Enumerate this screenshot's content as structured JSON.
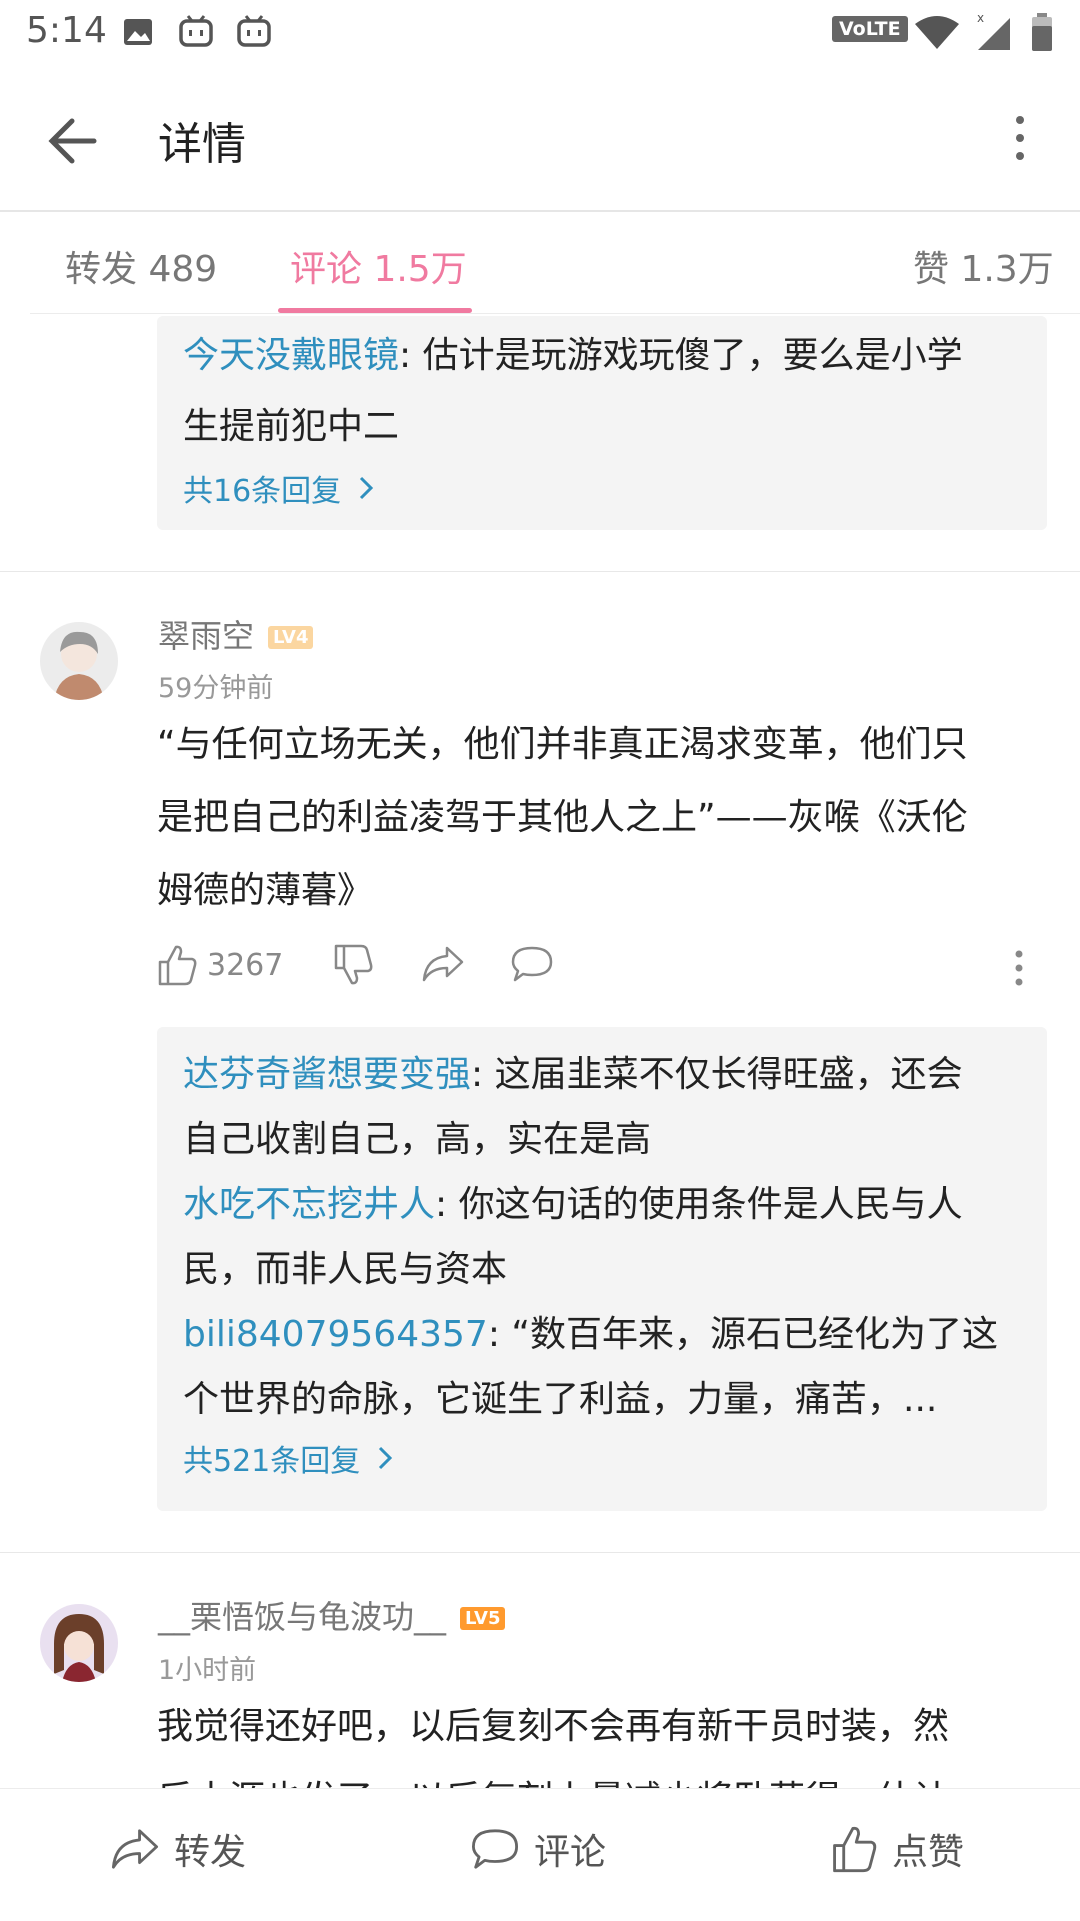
{
  "status_bar": {
    "time": "5:14",
    "volte": "VoLTE"
  },
  "app_bar": {
    "title": "详情"
  },
  "tabs": [
    {
      "label": "转发 489"
    },
    {
      "label": "评论 1.5万"
    },
    {
      "label": "赞 1.3万"
    }
  ],
  "prev_replies": {
    "items": [
      {
        "user": "今天没戴眼镜",
        "line1": ": 估计是玩游戏玩傻了，要么是小学",
        "line2": "生提前犯中二"
      }
    ],
    "more": "共16条回复"
  },
  "comments": [
    {
      "username": "翠雨空",
      "level": "LV4",
      "time": "59分钟前",
      "text_lines": [
        "“与任何立场无关，他们并非真正渴求变革，他们只",
        "是把自己的利益凌驾于其他人之上”——灰喉《沃伦",
        "姆德的薄暮》"
      ],
      "likes": "3267",
      "replies": [
        {
          "user": "达芬奇酱想要变强",
          "line1": ": 这届韭菜不仅长得旺盛，还会",
          "line2": "自己收割自己，高，实在是高"
        },
        {
          "user": "水吃不忘挖井人",
          "line1": ": 你这句话的使用条件是人民与人",
          "line2": "民，而非人民与资本"
        },
        {
          "user": "bili84079564357",
          "line1": ": “数百年来，源石已经化为了这",
          "line2": "个世界的命脉，它诞生了利益，力量，痛苦，..."
        }
      ],
      "more": "共521条回复"
    },
    {
      "username": "__栗悟饭与龟波功__",
      "level": "LV5",
      "time": "1小时前",
      "text_lines": [
        "我觉得还好吧，以后复刻不会再有新干员时装，然",
        "后土源也发了，以后复刻上量减少将卧薪得，估计"
      ]
    }
  ],
  "bottom_bar": {
    "repost": "转发",
    "comment": "评论",
    "like": "点赞"
  }
}
